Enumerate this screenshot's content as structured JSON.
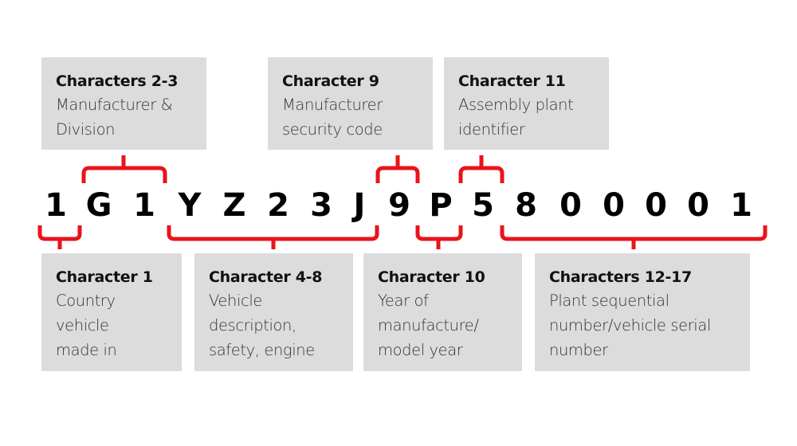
{
  "diagram": {
    "vin_characters": [
      "1",
      "G",
      "1",
      "Y",
      "Z",
      "2",
      "3",
      "J",
      "9",
      "P",
      "5",
      "8",
      "0",
      "0",
      "0",
      "0",
      "1"
    ],
    "bracket_color": "#e8141b",
    "box_color": "#dcdcdc",
    "top_labels": [
      {
        "title": "Characters 2-3",
        "lines": [
          "Manufacturer &",
          "Division"
        ],
        "positions": "2-3"
      },
      {
        "title": "Character 9",
        "lines": [
          "Manufacturer",
          "security code"
        ],
        "positions": "9"
      },
      {
        "title": "Character 11",
        "lines": [
          "Assembly plant",
          "identifier"
        ],
        "positions": "11"
      }
    ],
    "bottom_labels": [
      {
        "title": "Character 1",
        "lines": [
          "Country",
          "vehicle",
          "made in"
        ],
        "positions": "1"
      },
      {
        "title": "Character 4-8",
        "lines": [
          "Vehicle",
          "description,",
          "safety, engine"
        ],
        "positions": "4-8"
      },
      {
        "title": "Character 10",
        "lines": [
          "Year of",
          "manufacture/",
          "model year"
        ],
        "positions": "10"
      },
      {
        "title": "Characters 12-17",
        "lines": [
          "Plant sequential",
          "number/vehicle serial",
          "number"
        ],
        "positions": "12-17"
      }
    ]
  }
}
